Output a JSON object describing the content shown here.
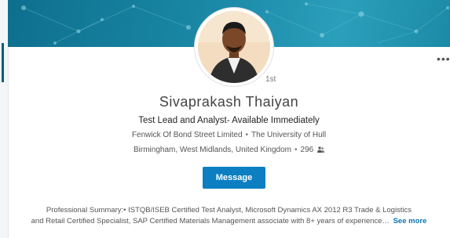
{
  "profile": {
    "name": "Sivaprakash Thaiyan",
    "degree": "1st",
    "headline": "Test Lead and Analyst- Available Immediately",
    "company": "Fenwick Of Bond Street Limited",
    "education": "The University of Hull",
    "separator": "•",
    "location": "Birmingham, West Midlands, United Kingdom",
    "connections": "296"
  },
  "actions": {
    "message_label": "Message",
    "more_label": "•••"
  },
  "summary": {
    "line1": "Professional Summary:• ISTQB/ISEB Certified Test Analyst, Microsoft Dynamics AX 2012 R3 Trade & Logistics",
    "line2": "and Retail Certified Specialist, SAP Certified Materials Management associate with 8+ years of experience…",
    "see_more_label": "See more"
  },
  "colors": {
    "banner": "#1a88a6",
    "accent": "#0b7fc2",
    "link": "#0b74b4"
  },
  "icons": {
    "connections": "connections-icon",
    "more": "more-icon"
  }
}
